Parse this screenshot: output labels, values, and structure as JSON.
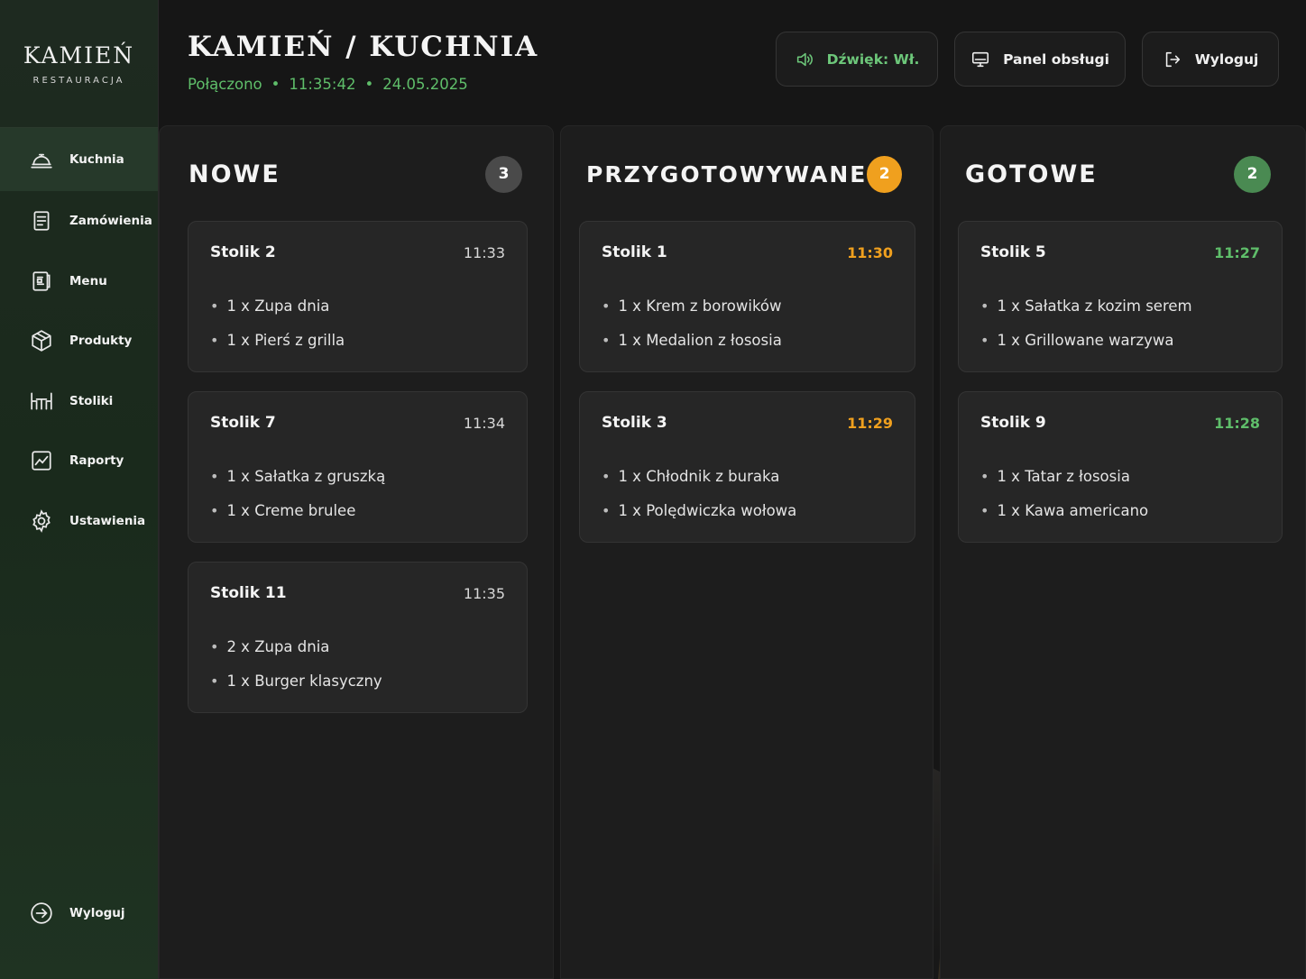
{
  "sidebar": {
    "logo_main": "KAMIEŃ",
    "logo_sub": "RESTAURACJA",
    "items": [
      {
        "label": "Kuchnia",
        "icon": "bell-icon",
        "active": true
      },
      {
        "label": "Zamówienia",
        "icon": "document-icon"
      },
      {
        "label": "Menu",
        "icon": "menu-book-icon"
      },
      {
        "label": "Produkty",
        "icon": "box-icon"
      },
      {
        "label": "Stoliki",
        "icon": "table-icon"
      },
      {
        "label": "Raporty",
        "icon": "chart-icon"
      },
      {
        "label": "Ustawienia",
        "icon": "gear-icon"
      }
    ],
    "logout_label": "Wyloguj"
  },
  "header": {
    "title": "KAMIEŃ / KUCHNIA",
    "status": {
      "connection": "Połączono",
      "time": "11:35:42",
      "date": "24.05.2025"
    },
    "sound_label": "Dźwięk: Wł.",
    "panel_label": "Panel obsługi",
    "logout_label": "Wyloguj"
  },
  "columns": [
    {
      "title": "NOWE",
      "count": "3",
      "cards": [
        {
          "table": "Stolik 2",
          "time": "11:33",
          "items": [
            "1 x Zupa dnia",
            "1 x Pierś z grilla"
          ]
        },
        {
          "table": "Stolik 7",
          "time": "11:34",
          "items": [
            "1 x Sałatka z gruszką",
            "1 x Creme brulee"
          ]
        },
        {
          "table": "Stolik 11",
          "time": "11:35",
          "items": [
            "2 x Zupa dnia",
            "1 x Burger klasyczny"
          ]
        }
      ]
    },
    {
      "title": "PRZYGOTOWYWANE",
      "count": "2",
      "cards": [
        {
          "table": "Stolik 1",
          "time": "11:30",
          "items": [
            "1 x Krem z borowików",
            "1 x Medalion z łososia"
          ]
        },
        {
          "table": "Stolik 3",
          "time": "11:29",
          "items": [
            "1 x Chłodnik z buraka",
            "1 x Polędwiczka wołowa"
          ]
        }
      ]
    },
    {
      "title": "GOTOWE",
      "count": "2",
      "cards": [
        {
          "table": "Stolik 5",
          "time": "11:27",
          "items": [
            "1 x Sałatka z kozim serem",
            "1 x Grillowane warzywa"
          ]
        },
        {
          "table": "Stolik 9",
          "time": "11:28",
          "items": [
            "1 x Tatar z łososia",
            "1 x Kawa americano"
          ]
        }
      ]
    }
  ],
  "colors": {
    "accent_green": "#5fbe6a",
    "accent_orange": "#f0a01e",
    "badge_green": "#4a8a52",
    "badge_gray": "#4a4a4a"
  }
}
